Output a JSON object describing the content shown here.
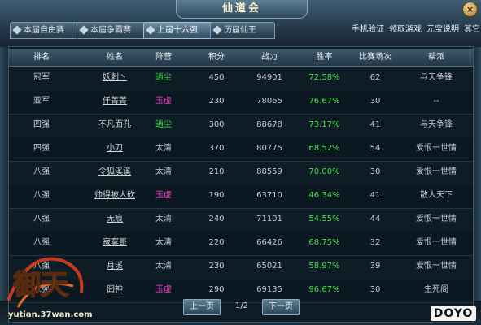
{
  "window": {
    "title": "仙道会",
    "close_label": "×"
  },
  "tabs": [
    {
      "label": "本届自由赛",
      "active": false
    },
    {
      "label": "本届争霸赛",
      "active": false
    },
    {
      "label": "上届十六强",
      "active": true
    },
    {
      "label": "历届仙王",
      "active": false
    }
  ],
  "top_links": [
    "手机验证",
    "领取游戏",
    "元宝说明",
    "其它"
  ],
  "table": {
    "headers": [
      "排名",
      "姓名",
      "阵营",
      "积分",
      "战力",
      "胜率",
      "比赛场次",
      "帮派"
    ],
    "rows": [
      {
        "rank": "冠军",
        "name": "妖刺丶",
        "camp": "逍尘",
        "camp_color": "#3ee23e",
        "score": "450",
        "power": "94901",
        "winrate": "72.58%",
        "matches": "62",
        "guild": "与天争锋"
      },
      {
        "rank": "亚军",
        "name": "仟菁菁",
        "camp": "玉虚",
        "camp_color": "#ff3ccf",
        "score": "230",
        "power": "78065",
        "winrate": "76.67%",
        "matches": "30",
        "guild": "--"
      },
      {
        "rank": "四强",
        "name": "不凡面孔",
        "camp": "逍尘",
        "camp_color": "#3ee23e",
        "score": "300",
        "power": "88678",
        "winrate": "73.17%",
        "matches": "41",
        "guild": "与天争锋"
      },
      {
        "rank": "四强",
        "name": "小刀",
        "camp": "太清",
        "camp_color": "#c3cdd5",
        "score": "370",
        "power": "80775",
        "winrate": "68.52%",
        "matches": "54",
        "guild": "爱恨一世情"
      },
      {
        "rank": "八强",
        "name": "令狐溪溪",
        "camp": "太清",
        "camp_color": "#c3cdd5",
        "score": "210",
        "power": "88559",
        "winrate": "70.00%",
        "matches": "30",
        "guild": "爱恨一世情"
      },
      {
        "rank": "八强",
        "name": "帅得被人砍",
        "camp": "玉虚",
        "camp_color": "#ff3ccf",
        "score": "190",
        "power": "63710",
        "winrate": "46.34%",
        "matches": "41",
        "guild": "散人天下"
      },
      {
        "rank": "八强",
        "name": "无痕",
        "camp": "太清",
        "camp_color": "#c3cdd5",
        "score": "240",
        "power": "71101",
        "winrate": "54.55%",
        "matches": "44",
        "guild": "爱恨一世情"
      },
      {
        "rank": "八强",
        "name": "寂寞哥",
        "camp": "太清",
        "camp_color": "#c3cdd5",
        "score": "220",
        "power": "66426",
        "winrate": "68.75%",
        "matches": "32",
        "guild": "爱恨一世情"
      },
      {
        "rank": "八强",
        "name": "月溪",
        "camp": "太清",
        "camp_color": "#c3cdd5",
        "score": "230",
        "power": "65021",
        "winrate": "58.97%",
        "matches": "39",
        "guild": "爱恨一世情"
      },
      {
        "rank": "八强",
        "name": "囧神",
        "camp": "玉虚",
        "camp_color": "#ff3ccf",
        "score": "290",
        "power": "69135",
        "winrate": "96.67%",
        "matches": "30",
        "guild": "生死阁"
      }
    ]
  },
  "pager": {
    "prev_label": "上一页",
    "page_info": "1/2",
    "next_label": "下一页"
  },
  "logo": {
    "text": "御天",
    "url_text": "yutian.37wan.com"
  },
  "watermark": "DOYO"
}
